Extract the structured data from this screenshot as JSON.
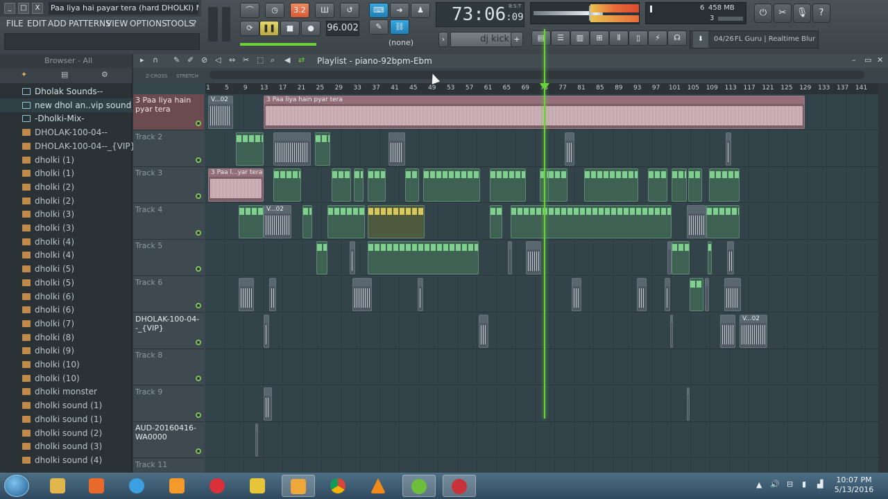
{
  "window": {
    "title": "Paa liya hai payar tera (hard DHOLKI) MIX.f...",
    "min_label": "_",
    "max_label": "□",
    "close_label": "X"
  },
  "menu": [
    "FILE",
    "EDIT",
    "ADD",
    "PATTERNS",
    "VIEW",
    "OPTIONS",
    "TOOLS",
    "?"
  ],
  "transport": {
    "pattern_mode_label": "3.2",
    "tempo": "96.002",
    "time": "73:06",
    "time_sub": "09",
    "time_unit": "B:S:T",
    "pattern_none": "(none)"
  },
  "monitor": {
    "cpu_a": "6",
    "memory": "458 MB",
    "voices": "3"
  },
  "pattern_selector": "dj kick",
  "news": {
    "counter": "04/26",
    "text": "FL Guru | Realtime Blur"
  },
  "browser": {
    "title": "Browser - All",
    "items": [
      {
        "label": "Dholak Sounds--",
        "kind": "folder"
      },
      {
        "label": "new dhol an..vip sound",
        "kind": "folder",
        "selected": true
      },
      {
        "label": "-Dholki-Mix-",
        "kind": "folder"
      },
      {
        "label": "DHOLAK-100-04--",
        "kind": "file"
      },
      {
        "label": "DHOLAK-100-04--_{VIP}",
        "kind": "file"
      },
      {
        "label": "dholki (1)",
        "kind": "file"
      },
      {
        "label": "dholki (1)",
        "kind": "file"
      },
      {
        "label": "dholki (2)",
        "kind": "file"
      },
      {
        "label": "dholki (2)",
        "kind": "file"
      },
      {
        "label": "dholki (3)",
        "kind": "file"
      },
      {
        "label": "dholki (3)",
        "kind": "file"
      },
      {
        "label": "dholki (4)",
        "kind": "file"
      },
      {
        "label": "dholki (4)",
        "kind": "file"
      },
      {
        "label": "dholki (5)",
        "kind": "file"
      },
      {
        "label": "dholki (5)",
        "kind": "file"
      },
      {
        "label": "dholki (6)",
        "kind": "file"
      },
      {
        "label": "dholki (6)",
        "kind": "file"
      },
      {
        "label": "dholki (7)",
        "kind": "file"
      },
      {
        "label": "dholki (8)",
        "kind": "file"
      },
      {
        "label": "dholki (9)",
        "kind": "file"
      },
      {
        "label": "dholki (10)",
        "kind": "file"
      },
      {
        "label": "dholki (10)",
        "kind": "file"
      },
      {
        "label": "dholki monster",
        "kind": "file"
      },
      {
        "label": "dholki sound (1)",
        "kind": "file"
      },
      {
        "label": "dholki sound (1)",
        "kind": "file"
      },
      {
        "label": "dholki sound (2)",
        "kind": "file"
      },
      {
        "label": "dholki sound (3)",
        "kind": "file"
      },
      {
        "label": "dholki sound (4)",
        "kind": "file"
      }
    ]
  },
  "playlist": {
    "title": "Playlist - piano-92bpm-Ebm",
    "snap_labels": [
      "Z-CROSS",
      "STRETCH"
    ],
    "ruler": [
      "1",
      "5",
      "9",
      "13",
      "17",
      "21",
      "25",
      "29",
      "33",
      "37",
      "41",
      "45",
      "49",
      "53",
      "57",
      "61",
      "65",
      "69",
      "73",
      "77",
      "81",
      "85",
      "89",
      "93",
      "97",
      "101",
      "105",
      "109",
      "113",
      "117",
      "121",
      "125",
      "129",
      "133",
      "137",
      "141"
    ],
    "tracks": [
      {
        "name": "3 Paa liya hain pyar tera",
        "style": "red"
      },
      {
        "name": "Track 2",
        "style": ""
      },
      {
        "name": "Track 3",
        "style": ""
      },
      {
        "name": "Track 4",
        "style": ""
      },
      {
        "name": "Track 5",
        "style": ""
      },
      {
        "name": "Track 6",
        "style": ""
      },
      {
        "name": "DHOLAK-100-04--_{VIP}",
        "style": "named"
      },
      {
        "name": "Track 8",
        "style": ""
      },
      {
        "name": "Track 9",
        "style": ""
      },
      {
        "name": "AUD-20160416-WA0000",
        "style": "named"
      },
      {
        "name": "Track 11",
        "style": ""
      }
    ],
    "clip_labels": {
      "v02": "V...02",
      "song": "3 Paa liya hain pyar tera",
      "song_short": "3 Paa l...yar tera"
    }
  },
  "taskbar": {
    "time": "10:07 PM",
    "date": "5/13/2016"
  }
}
